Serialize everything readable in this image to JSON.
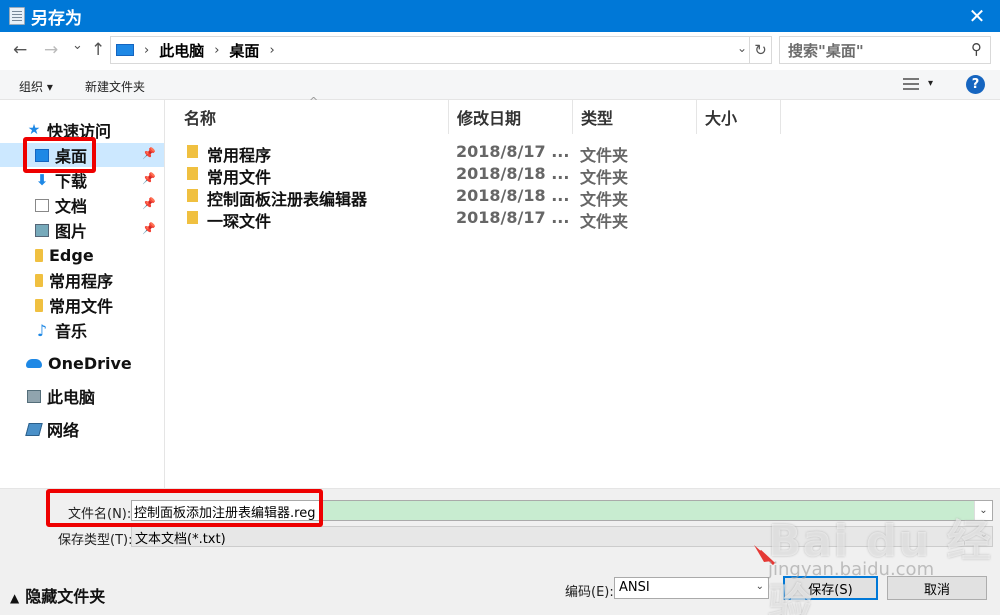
{
  "window": {
    "title": "另存为",
    "close_glyph": "✕"
  },
  "address": {
    "back": "←",
    "forward": "→",
    "recent": "⌄",
    "up": "↑",
    "segments": [
      "此电脑",
      "桌面"
    ],
    "search_placeholder": "搜索\"桌面\""
  },
  "toolbar": {
    "organize": "组织 ▾",
    "new_folder": "新建文件夹",
    "help": "?"
  },
  "sidebar": {
    "items": [
      {
        "label": "快速访问",
        "icon": "star-icon"
      },
      {
        "label": "桌面",
        "icon": "desktop-icon",
        "pinned": true,
        "selected": true
      },
      {
        "label": "下载",
        "icon": "download-icon",
        "pinned": true
      },
      {
        "label": "文档",
        "icon": "document-icon",
        "pinned": true
      },
      {
        "label": "图片",
        "icon": "picture-icon",
        "pinned": true
      },
      {
        "label": "Edge",
        "icon": "folder-icon"
      },
      {
        "label": "常用程序",
        "icon": "folder-icon"
      },
      {
        "label": "常用文件",
        "icon": "folder-icon"
      },
      {
        "label": "音乐",
        "icon": "music-icon"
      },
      {
        "label": "OneDrive",
        "icon": "cloud-icon"
      },
      {
        "label": "此电脑",
        "icon": "computer-icon"
      },
      {
        "label": "网络",
        "icon": "network-icon"
      }
    ]
  },
  "files": {
    "columns": [
      "名称",
      "修改日期",
      "类型",
      "大小"
    ],
    "rows": [
      {
        "name": "常用程序",
        "date": "2018/8/17 ...",
        "type": "文件夹"
      },
      {
        "name": "常用文件",
        "date": "2018/8/18 ...",
        "type": "文件夹"
      },
      {
        "name": "控制面板注册表编辑器",
        "date": "2018/8/18 ...",
        "type": "文件夹"
      },
      {
        "name": "一琛文件",
        "date": "2018/8/17 ...",
        "type": "文件夹"
      }
    ]
  },
  "save": {
    "filename_label": "文件名(N):",
    "filename_value": "控制面板添加注册表编辑器.reg",
    "filetype_label": "保存类型(T):",
    "filetype_value": "文本文档(*.txt)",
    "hide_folders": "隐藏文件夹",
    "encoding_label": "编码(E):",
    "encoding_value": "ANSI",
    "save_button": "保存(S)",
    "cancel_button": "取消"
  },
  "watermark": {
    "brand": "Bai du 经验",
    "url": "jingyan.baidu.com"
  },
  "colors": {
    "titlebar": "#0078d7",
    "selection": "#cce8ff",
    "highlight_box": "#ee0000",
    "filename_fill": "#c8ecd0"
  }
}
